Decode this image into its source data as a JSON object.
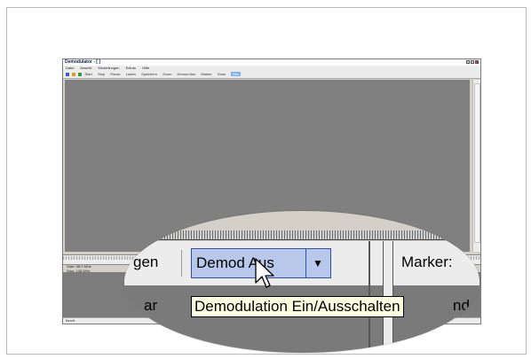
{
  "app": {
    "title": "Demodulator - [ ]",
    "menu": [
      "Datei",
      "Ansicht",
      "Einstellungen",
      "Extras",
      "Hilfe"
    ],
    "toolbar": [
      "Start",
      "Stop",
      "Pause",
      "Laden",
      "Speichern",
      "Zoom",
      "Demod Aus",
      "Marker",
      "Scan",
      "Rec"
    ],
    "lower_label_line1": "Start: 88.0 MHz",
    "lower_label_line2": "Stop: 108 MHz",
    "status": "Bereit"
  },
  "magnifier": {
    "left_fragment_top": "gen",
    "left_fragment_bottom": "ar",
    "demod_button_label": "Demod Aus",
    "marker_label": "Marker:",
    "right_fragment_bottom": "nd"
  },
  "tooltip": {
    "text": "Demodulation Ein/Ausschalten"
  }
}
